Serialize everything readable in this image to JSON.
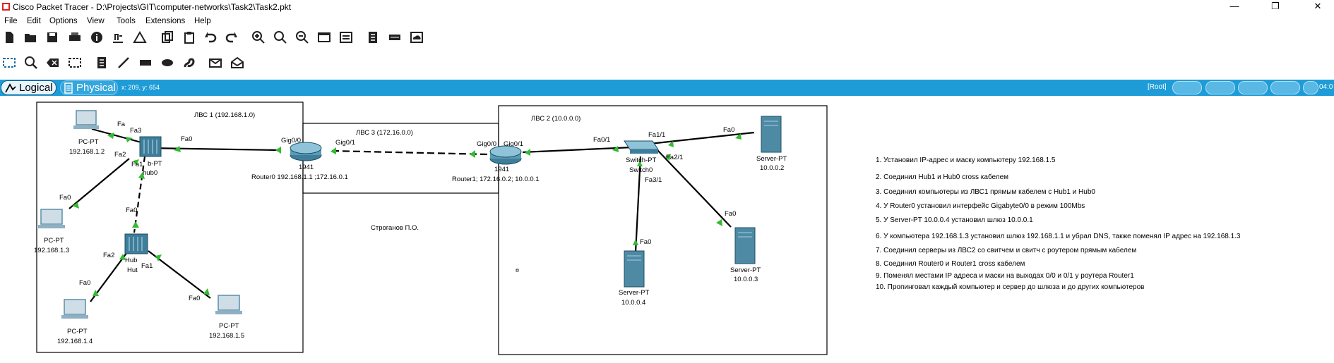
{
  "window": {
    "title": "Cisco Packet Tracer - D:\\Projects\\GIT\\computer-networks\\Task2\\Task2.pkt",
    "minimize": "—",
    "restore": "❐",
    "close": "✕"
  },
  "menu": [
    "File",
    "Edit",
    "Options",
    "View",
    "Tools",
    "Extensions",
    "Help"
  ],
  "modebar": {
    "logical_label": "Logical",
    "physical_label": "Physical",
    "coords": "x: 209, y: 654",
    "root_label": "[Root]",
    "clock": "04:0"
  },
  "areas": {
    "lan1": "ЛВС 1 (192.168.1.0)",
    "lan2": "ЛВС 2 (10.0.0.0)",
    "lan3": "ЛВС 3 (172.16.0.0)"
  },
  "author": "Строганов П.О.",
  "devices": {
    "pc2": {
      "type": "PC-PT",
      "ip": "192.168.1.2"
    },
    "pc3": {
      "type": "PC-PT",
      "ip": "192.168.1.3"
    },
    "pc4": {
      "type": "PC-PT",
      "ip": "192.168.1.4"
    },
    "pc5": {
      "type": "PC-PT",
      "ip": "192.168.1.5"
    },
    "hub0": {
      "type": "b-PT",
      "name": "hub0"
    },
    "hub1": {
      "type": "Hub",
      "name": "Hut"
    },
    "router0": {
      "model": "1941",
      "label": "Router0 192.168.1.1 ;172.16.0.1"
    },
    "router1": {
      "model": "1941",
      "label": "Router1; 172.16.0.2; 10.0.0.1"
    },
    "switch0": {
      "type": "Switch-PT",
      "name": "Switch0"
    },
    "srv2": {
      "type": "Server-PT",
      "ip": "10.0.0.2"
    },
    "srv3": {
      "type": "Server-PT",
      "ip": "10.0.0.3"
    },
    "srv4": {
      "type": "Server-PT",
      "ip": "10.0.0.4"
    }
  },
  "ports": {
    "pc2_fa": "Fa",
    "hub0_fa3": "Fa3",
    "hub0_fa0": "Fa0",
    "hub0_fa2": "Fa2",
    "hub0_fa1": "Fa1",
    "pc3_fa0": "Fa0",
    "hub1_fa0": "Fa0",
    "hub1_fa2": "Fa2",
    "hub1_fa1": "Fa1",
    "pc4_fa0": "Fa0",
    "pc5_fa0": "Fa0",
    "r0_gig00": "Gig0/0",
    "r0_gig01": "Gig0/1",
    "r1_gig00": "Gig0/0",
    "r1_gig01": "Gig0/1",
    "sw_fa01": "Fa0/1",
    "sw_fa11": "Fa1/1",
    "sw_fa21": "Fa2/1",
    "sw_fa31": "Fa3/1",
    "srv2_fa0": "Fa0",
    "srv3_fa0": "Fa0",
    "srv4_fa0": "Fa0"
  },
  "notes": [
    "1. Установил IP-адрес и маску компьютеру 192.168.1.5",
    "2. Соединил Hub1 и Hub0 cross кабелем",
    "3. Соединил компьютеры из ЛВС1 прямым кабелем с Hub1 и Hub0",
    "4. У Router0 установил интерфейс Gigabyte0/0 в режим 100Mbs",
    "5. У Server-PT 10.0.0.4 установил шлюз 10.0.0.1",
    "6. У компьютера 192.168.1.3 установил шлюз 192.168.1.1 и убрал DNS, также поменял IP адрес на 192.168.1.3",
    "7. Соединил серверы из ЛВС2 со свитчем и свитч с роутером прямым кабелем",
    "8. Соединил Router0 и Router1 cross кабелем",
    "9. Поменял местами IP адреса и маски на выходах 0/0 и 0/1 у роутера Router1",
    "10. Пропинговал каждый компьютер и сервер до шлюза и до других компьютеров"
  ],
  "colors": {
    "modebar": "#1e9cd8",
    "link_up": "#33bb33",
    "device": "#5a8fa8"
  }
}
